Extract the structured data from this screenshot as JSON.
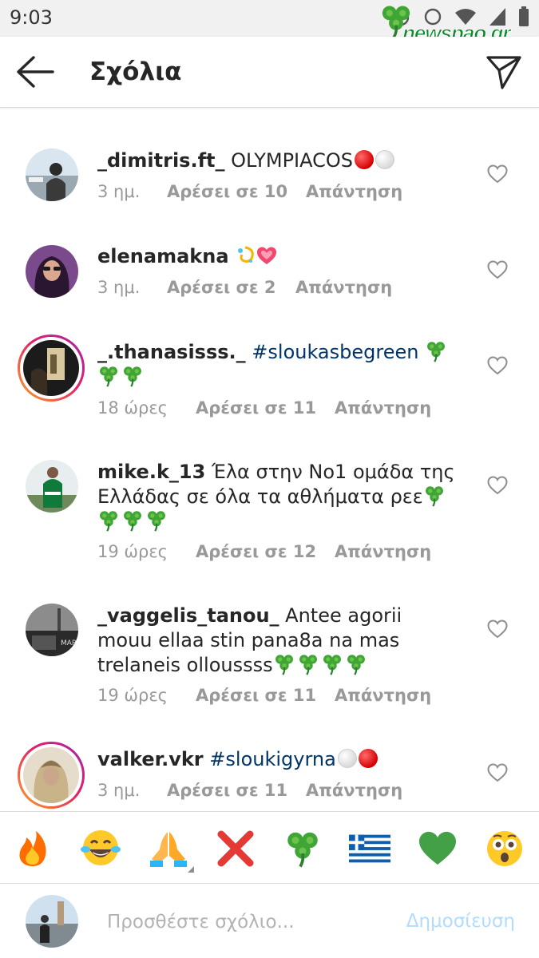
{
  "status_bar": {
    "time": "9:03",
    "watermark_text": "newspao.gr",
    "icons": [
      "alarm-icon",
      "data-saver-icon",
      "wifi-icon",
      "signal-icon",
      "battery-icon"
    ]
  },
  "header": {
    "title": "Σχόλια",
    "back_icon": "arrow-left-icon",
    "send_icon": "paper-plane-icon"
  },
  "comments": [
    {
      "username": "_dimitris.ft_",
      "text": " OLYMPIACOS",
      "time": "3 ημ.",
      "likes": "Αρέσει σε 10",
      "reply": "Απάντηση",
      "has_story_ring": false
    },
    {
      "username": "elenamakna",
      "text": " ",
      "time": "3 ημ.",
      "likes": "Αρέσει σε 2",
      "reply": "Απάντηση",
      "has_story_ring": false
    },
    {
      "username": "_.thanasisss._",
      "hashtag": "#sloukasbegreen",
      "time": "18 ώρες",
      "likes": "Αρέσει σε 11",
      "reply": "Απάντηση",
      "has_story_ring": true
    },
    {
      "username": "mike.k_13",
      "text": " Έλα στην Νο1 ομάδα της Ελλάδας σε όλα τα αθλήματα ρεε",
      "time": "19 ώρες",
      "likes": "Αρέσει σε 12",
      "reply": "Απάντηση",
      "has_story_ring": false
    },
    {
      "username": "_vaggelis_tanou_",
      "text": " Antee agorii mouu ellaa stin pana8a na mas trelaneis olloussss",
      "time": "19 ώρες",
      "likes": "Αρέσει σε 11",
      "reply": "Απάντηση",
      "has_story_ring": false
    },
    {
      "username": "valker.vkr",
      "hashtag": "#sloukigyrna",
      "time": "3 ημ.",
      "likes": "Αρέσει σε 11",
      "reply": "Απάντηση",
      "has_story_ring": true
    }
  ],
  "emoji_bar": [
    "fire-emoji",
    "tears-of-joy-emoji",
    "folded-hands-emoji",
    "cross-mark-emoji",
    "shamrock-emoji",
    "greek-flag-emoji",
    "green-heart-emoji",
    "astonished-face-emoji"
  ],
  "input": {
    "placeholder": "Προσθέστε σχόλιο...",
    "post_label": "Δημοσίευση"
  },
  "colors": {
    "hashtag": "#003569",
    "muted": "#999999",
    "post_disabled": "#b3dbff",
    "shamrock": "#3fa535"
  }
}
